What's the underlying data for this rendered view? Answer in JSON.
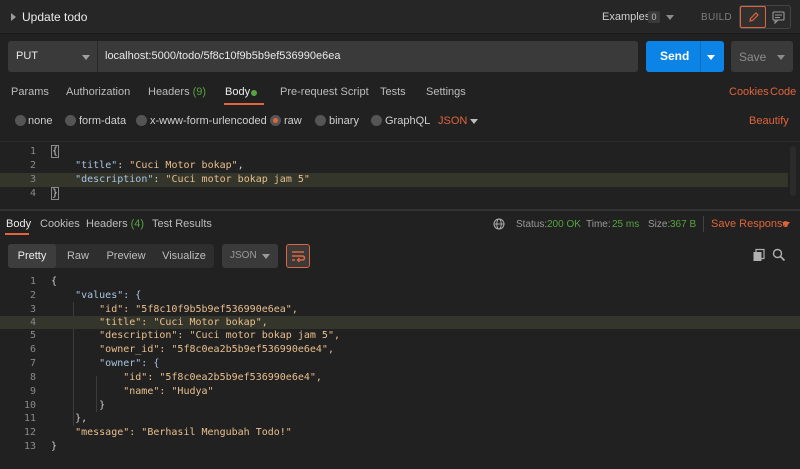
{
  "header": {
    "title": "Update todo",
    "examples_label": "Examples",
    "examples_count": "0",
    "build_label": "BUILD"
  },
  "request": {
    "method": "PUT",
    "url": "localhost:5000/todo/5f8c10f9b5b9ef536990e6ea",
    "send_label": "Send",
    "save_label": "Save"
  },
  "request_tabs": {
    "params": "Params",
    "authorization": "Authorization",
    "headers": "Headers",
    "headers_count": "(9)",
    "body": "Body",
    "prerequest": "Pre-request Script",
    "tests": "Tests",
    "settings": "Settings",
    "cookies": "Cookies",
    "code": "Code"
  },
  "body_types": {
    "none": "none",
    "form_data": "form-data",
    "urlencoded": "x-www-form-urlencoded",
    "raw": "raw",
    "binary": "binary",
    "graphql": "GraphQL",
    "format": "JSON",
    "beautify": "Beautify",
    "selected": "raw"
  },
  "request_body": {
    "lines": [
      {
        "n": "1",
        "key": "",
        "val": "",
        "pre": "{",
        "post": ""
      },
      {
        "n": "2",
        "key": "\"title\"",
        "val": "\"Cuci Motor bokap\"",
        "pre": "    ",
        "post": ","
      },
      {
        "n": "3",
        "key": "\"description\"",
        "val": "\"Cuci motor bokap jam 5\"",
        "pre": "    ",
        "post": ""
      },
      {
        "n": "4",
        "key": "",
        "val": "",
        "pre": "}",
        "post": ""
      }
    ]
  },
  "response_tabs": {
    "body": "Body",
    "cookies": "Cookies",
    "headers": "Headers",
    "headers_count": "(4)",
    "test_results": "Test Results",
    "status_label": "Status:",
    "status_value": "200 OK",
    "time_label": "Time:",
    "time_value": "25 ms",
    "size_label": "Size:",
    "size_value": "367 B",
    "save_response": "Save Response"
  },
  "response_toolbar": {
    "pretty": "Pretty",
    "raw": "Raw",
    "preview": "Preview",
    "visualize": "Visualize",
    "format": "JSON"
  },
  "response_body": {
    "lines": [
      {
        "n": "1",
        "text": "{"
      },
      {
        "n": "2",
        "text": "    \"values\": {"
      },
      {
        "n": "3",
        "text": "        \"id\": \"5f8c10f9b5b9ef536990e6ea\","
      },
      {
        "n": "4",
        "text": "        \"title\": \"Cuci Motor bokap\","
      },
      {
        "n": "5",
        "text": "        \"description\": \"Cuci motor bokap jam 5\","
      },
      {
        "n": "6",
        "text": "        \"owner_id\": \"5f8c0ea2b5b9ef536990e6e4\","
      },
      {
        "n": "7",
        "text": "        \"owner\": {"
      },
      {
        "n": "8",
        "text": "            \"id\": \"5f8c0ea2b5b9ef536990e6e4\","
      },
      {
        "n": "9",
        "text": "            \"name\": \"Hudya\""
      },
      {
        "n": "10",
        "text": "        }"
      },
      {
        "n": "11",
        "text": "    },"
      },
      {
        "n": "12",
        "text": "    \"message\": \"Berhasil Mengubah Todo!\""
      },
      {
        "n": "13",
        "text": "}"
      }
    ]
  },
  "colors": {
    "accent": "#e0643c",
    "send": "#0b84e6",
    "success": "#57a340",
    "json_key": "#a7c4e3",
    "json_string": "#e9bf8d"
  }
}
